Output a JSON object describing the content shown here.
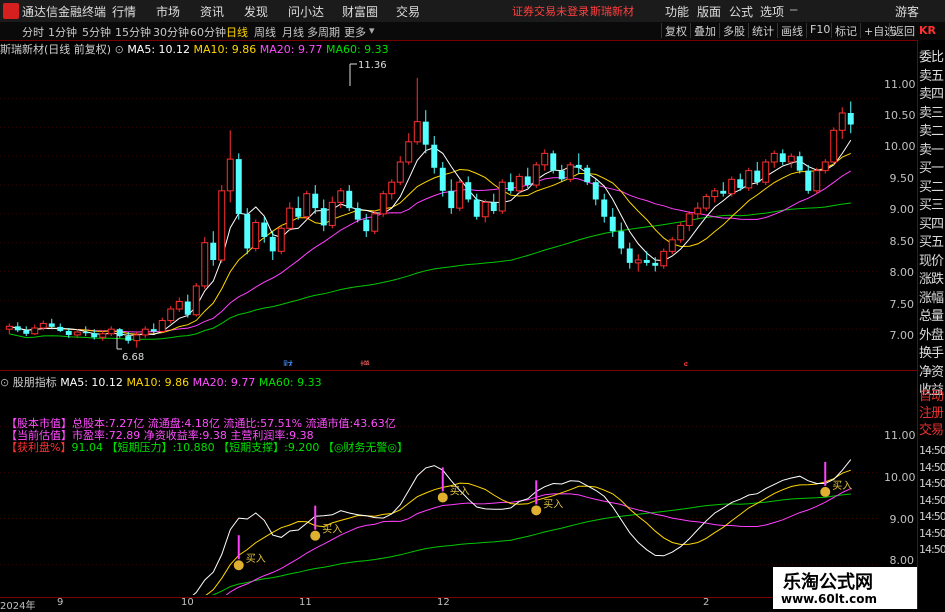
{
  "window": {
    "title": "通达信金融终端"
  },
  "menu": {
    "items": [
      "行情",
      "市场",
      "资讯",
      "发现",
      "问小达",
      "财富圈",
      "交易"
    ],
    "login_notice": "证券交易未登录",
    "stock_name": "斯瑞新材",
    "right_items": [
      "功能",
      "版面",
      "公式",
      "选项"
    ],
    "guest": "游客"
  },
  "toolbar": {
    "periods": [
      "分时",
      "1分钟",
      "5分钟",
      "15分钟",
      "30分钟",
      "60分钟",
      "日线",
      "周线",
      "月线",
      "多周期",
      "更多"
    ],
    "active_period": "日线",
    "right_buttons": [
      "复权",
      "叠加",
      "多股",
      "统计",
      "画线",
      "F10",
      "标记",
      "+自选",
      "返回"
    ]
  },
  "main_chart": {
    "title": "斯瑞新材(日线 前复权)",
    "ma": [
      {
        "label": "MA5: 10.12",
        "color": "#ffffff"
      },
      {
        "label": "MA10: 9.86",
        "color": "#ffd700"
      },
      {
        "label": "MA20: 9.77",
        "color": "#ff4dff"
      },
      {
        "label": "MA60: 9.33",
        "color": "#00e000"
      }
    ],
    "y_ticks": [
      "11.00",
      "10.50",
      "10.00",
      "9.50",
      "9.00",
      "8.50",
      "8.00",
      "7.50",
      "7.00"
    ],
    "high_label": "11.36",
    "low_label": "6.68",
    "markers": [
      "财",
      "增",
      "$"
    ]
  },
  "sub_chart": {
    "title": "股朋指标",
    "ma": [
      {
        "label": "MA5: 10.12",
        "color": "#ffffff"
      },
      {
        "label": "MA10: 9.86",
        "color": "#ffd700"
      },
      {
        "label": "MA20: 9.77",
        "color": "#ff4dff"
      },
      {
        "label": "MA60: 9.33",
        "color": "#00e000"
      }
    ],
    "y_ticks": [
      "11.00",
      "10.00",
      "9.00",
      "8.00"
    ],
    "info_lines": [
      {
        "label": "【股本市值】",
        "text": "总股本:7.27亿 流通盘:4.18亿 流通比:57.51% 流通市值:43.63亿"
      },
      {
        "label": "【当前估值】",
        "text": "市盈率:72.89 净资收益率:9.38 主营利润率:9.38"
      },
      {
        "label": "【获利盘%】",
        "text": "91.04 【短期压力】:10.880 【短期支撑】:9.200 【◎财务无警◎】"
      }
    ],
    "buy_label": "买入"
  },
  "x_axis": {
    "labels": [
      "2024年",
      "9",
      "10",
      "11",
      "12",
      "2"
    ]
  },
  "sidebar": {
    "logo": "KR",
    "items": [
      "委比",
      "卖五",
      "卖四",
      "卖三",
      "卖二",
      "卖一",
      "买一",
      "买二",
      "买三",
      "买四",
      "买五",
      "现价",
      "涨跌",
      "涨幅",
      "总量",
      "外盘",
      "换手",
      "净资",
      "收益",
      "自动",
      "注册",
      "交易",
      "14:50",
      "14:50",
      "14:50",
      "14:50",
      "14:50",
      "14:50",
      "14:50"
    ]
  },
  "watermark": {
    "line1": "乐淘公式网",
    "line2": "www.60lt.com"
  },
  "chart_data": {
    "type": "candlestick",
    "title": "斯瑞新材(日线 前复权)",
    "y_range": [
      6.5,
      11.6
    ],
    "up_color": "#ff3030",
    "down_color": "#54ffff",
    "candles": [
      [
        7.0,
        7.1,
        6.92,
        7.05
      ],
      [
        7.05,
        7.12,
        6.95,
        6.98
      ],
      [
        6.98,
        7.05,
        6.88,
        6.92
      ],
      [
        6.92,
        7.08,
        6.9,
        7.02
      ],
      [
        7.02,
        7.15,
        6.98,
        7.1
      ],
      [
        7.1,
        7.18,
        7.0,
        7.04
      ],
      [
        7.04,
        7.1,
        6.95,
        6.97
      ],
      [
        6.97,
        7.02,
        6.85,
        6.9
      ],
      [
        6.9,
        7.0,
        6.85,
        6.95
      ],
      [
        6.95,
        7.05,
        6.88,
        6.93
      ],
      [
        6.93,
        7.0,
        6.82,
        6.86
      ],
      [
        6.86,
        6.98,
        6.8,
        6.92
      ],
      [
        6.92,
        7.05,
        6.88,
        7.0
      ],
      [
        7.0,
        7.02,
        6.85,
        6.88
      ],
      [
        6.88,
        6.95,
        6.75,
        6.8
      ],
      [
        6.8,
        6.95,
        6.68,
        6.9
      ],
      [
        6.9,
        7.05,
        6.85,
        7.0
      ],
      [
        7.0,
        7.1,
        6.92,
        6.96
      ],
      [
        6.96,
        7.2,
        6.94,
        7.15
      ],
      [
        7.15,
        7.4,
        7.1,
        7.35
      ],
      [
        7.35,
        7.55,
        7.3,
        7.48
      ],
      [
        7.48,
        7.6,
        7.2,
        7.25
      ],
      [
        7.25,
        7.8,
        7.22,
        7.75
      ],
      [
        7.75,
        8.6,
        7.7,
        8.5
      ],
      [
        8.5,
        8.7,
        8.1,
        8.2
      ],
      [
        8.2,
        9.5,
        8.15,
        9.4
      ],
      [
        9.4,
        10.45,
        9.2,
        9.95
      ],
      [
        9.95,
        10.05,
        8.9,
        9.0
      ],
      [
        9.0,
        9.1,
        8.3,
        8.4
      ],
      [
        8.4,
        8.9,
        8.35,
        8.85
      ],
      [
        8.85,
        8.95,
        8.5,
        8.6
      ],
      [
        8.6,
        8.7,
        8.2,
        8.35
      ],
      [
        8.35,
        8.8,
        8.3,
        8.75
      ],
      [
        8.75,
        9.2,
        8.7,
        9.1
      ],
      [
        9.1,
        9.3,
        8.9,
        8.95
      ],
      [
        8.95,
        9.4,
        8.9,
        9.35
      ],
      [
        9.35,
        9.5,
        9.0,
        9.1
      ],
      [
        9.1,
        9.25,
        8.7,
        8.8
      ],
      [
        8.8,
        9.3,
        8.75,
        9.2
      ],
      [
        9.2,
        9.45,
        9.1,
        9.4
      ],
      [
        9.4,
        9.5,
        9.05,
        9.1
      ],
      [
        9.1,
        9.2,
        8.85,
        8.9
      ],
      [
        8.9,
        9.0,
        8.6,
        8.7
      ],
      [
        8.7,
        9.05,
        8.65,
        9.0
      ],
      [
        9.0,
        9.4,
        8.95,
        9.35
      ],
      [
        9.35,
        9.6,
        9.25,
        9.55
      ],
      [
        9.55,
        10.0,
        9.5,
        9.9
      ],
      [
        9.9,
        10.4,
        9.85,
        10.25
      ],
      [
        10.25,
        11.36,
        10.2,
        10.6
      ],
      [
        10.6,
        10.8,
        10.05,
        10.2
      ],
      [
        10.2,
        10.35,
        9.7,
        9.8
      ],
      [
        9.8,
        9.9,
        9.3,
        9.4
      ],
      [
        9.4,
        9.6,
        9.0,
        9.1
      ],
      [
        9.1,
        9.6,
        9.05,
        9.55
      ],
      [
        9.55,
        9.65,
        9.2,
        9.25
      ],
      [
        9.25,
        9.35,
        8.9,
        8.95
      ],
      [
        8.95,
        9.25,
        8.85,
        9.2
      ],
      [
        9.2,
        9.35,
        9.0,
        9.05
      ],
      [
        9.05,
        9.6,
        9.0,
        9.55
      ],
      [
        9.55,
        9.7,
        9.35,
        9.4
      ],
      [
        9.4,
        9.7,
        9.35,
        9.65
      ],
      [
        9.65,
        9.8,
        9.45,
        9.5
      ],
      [
        9.5,
        9.9,
        9.45,
        9.85
      ],
      [
        9.85,
        10.12,
        9.75,
        10.05
      ],
      [
        10.05,
        10.1,
        9.7,
        9.75
      ],
      [
        9.75,
        9.85,
        9.55,
        9.6
      ],
      [
        9.6,
        9.9,
        9.55,
        9.85
      ],
      [
        9.85,
        10.05,
        9.7,
        9.8
      ],
      [
        9.8,
        9.85,
        9.5,
        9.55
      ],
      [
        9.55,
        9.6,
        9.15,
        9.25
      ],
      [
        9.25,
        9.35,
        8.85,
        8.95
      ],
      [
        8.95,
        9.1,
        8.6,
        8.7
      ],
      [
        8.7,
        8.85,
        8.3,
        8.4
      ],
      [
        8.4,
        8.5,
        8.05,
        8.15
      ],
      [
        8.15,
        8.3,
        8.0,
        8.2
      ],
      [
        8.2,
        8.35,
        8.1,
        8.15
      ],
      [
        8.15,
        8.25,
        8.0,
        8.1
      ],
      [
        8.1,
        8.4,
        8.05,
        8.35
      ],
      [
        8.35,
        8.6,
        8.3,
        8.55
      ],
      [
        8.55,
        8.85,
        8.5,
        8.8
      ],
      [
        8.8,
        9.05,
        8.7,
        9.0
      ],
      [
        9.0,
        9.2,
        8.9,
        9.1
      ],
      [
        9.1,
        9.35,
        9.05,
        9.3
      ],
      [
        9.3,
        9.45,
        9.2,
        9.4
      ],
      [
        9.4,
        9.55,
        9.3,
        9.35
      ],
      [
        9.35,
        9.65,
        9.3,
        9.6
      ],
      [
        9.6,
        9.7,
        9.4,
        9.45
      ],
      [
        9.45,
        9.8,
        9.4,
        9.75
      ],
      [
        9.75,
        9.9,
        9.5,
        9.55
      ],
      [
        9.55,
        9.95,
        9.5,
        9.9
      ],
      [
        9.9,
        10.1,
        9.8,
        10.05
      ],
      [
        10.05,
        10.12,
        9.85,
        9.9
      ],
      [
        9.9,
        10.05,
        9.8,
        10.0
      ],
      [
        10.0,
        10.08,
        9.7,
        9.75
      ],
      [
        9.75,
        9.85,
        9.35,
        9.4
      ],
      [
        9.4,
        9.8,
        9.35,
        9.75
      ],
      [
        9.75,
        9.95,
        9.7,
        9.9
      ],
      [
        9.9,
        10.5,
        9.85,
        10.45
      ],
      [
        10.45,
        10.85,
        10.3,
        10.75
      ],
      [
        10.75,
        10.95,
        10.4,
        10.55
      ]
    ]
  }
}
